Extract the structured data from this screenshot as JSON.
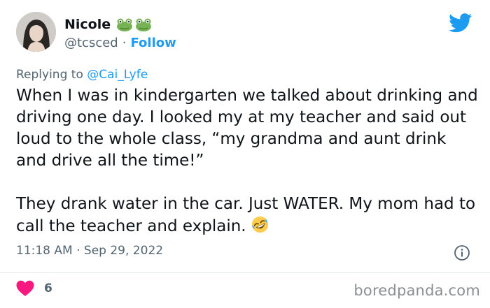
{
  "tweet": {
    "display_name": "Nicole",
    "name_emojis": [
      "frog-emoji",
      "frog-emoji"
    ],
    "handle": "@tcsced",
    "separator": "·",
    "follow_label": "Follow",
    "reply_prefix": "Replying to",
    "reply_handle": "@Cai_Lyfe",
    "body_paragraph_1": "When I was in kindergarten we talked about drinking and driving one day. I looked my at my teacher and said out loud to the whole class, “my grandma and aunt drink and drive all the time!”",
    "body_paragraph_2": "They drank water in the car. Just WATER. My mom had to call the teacher and explain.",
    "body_emoji": "rolling-on-floor-laughing-emoji",
    "time": "11:18 AM",
    "meta_separator": "·",
    "date": "Sep 29, 2022",
    "like_count": "6"
  },
  "icons": {
    "brand": "twitter-bird-icon",
    "info": "info-icon",
    "like": "heart-icon"
  },
  "colors": {
    "accent": "#1d9bf0",
    "heart": "#f91880",
    "secondary_text": "#536471"
  },
  "watermark": "boredpanda.com"
}
